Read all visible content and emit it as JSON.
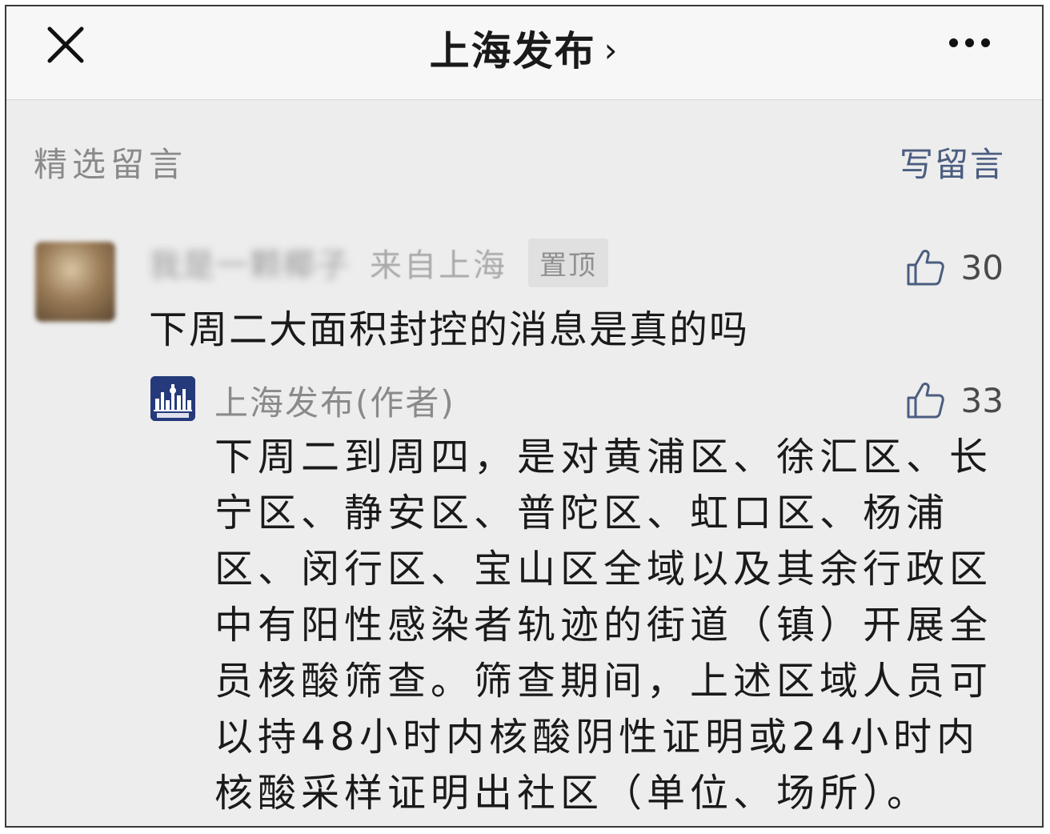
{
  "navbar": {
    "title": "上海发布",
    "chevron": "›",
    "close_icon": "close-icon",
    "more_icon": "more-icon"
  },
  "section": {
    "title": "精选留言",
    "write_label": "写留言"
  },
  "comment": {
    "nickname": "我是一颗椰子",
    "location": "来自上海",
    "pinned_label": "置顶",
    "likes": "30",
    "text": "下周二大面积封控的消息是真的吗"
  },
  "reply": {
    "author": "上海发布(作者)",
    "likes": "33",
    "text": "下周二到周四，是对黄浦区、徐汇区、长宁区、静安区、普陀区、虹口区、杨浦区、闵行区、宝山区全域以及其余行政区中有阳性感染者轨迹的街道（镇）开展全员核酸筛查。筛查期间，上述区域人员可以持48小时内核酸阴性证明或24小时内核酸采样证明出社区（单位、场所）。"
  },
  "colors": {
    "background": "#ededed",
    "navbar": "#f7f7f7",
    "link": "#4b5d80",
    "author_avatar": "#253a7a"
  }
}
